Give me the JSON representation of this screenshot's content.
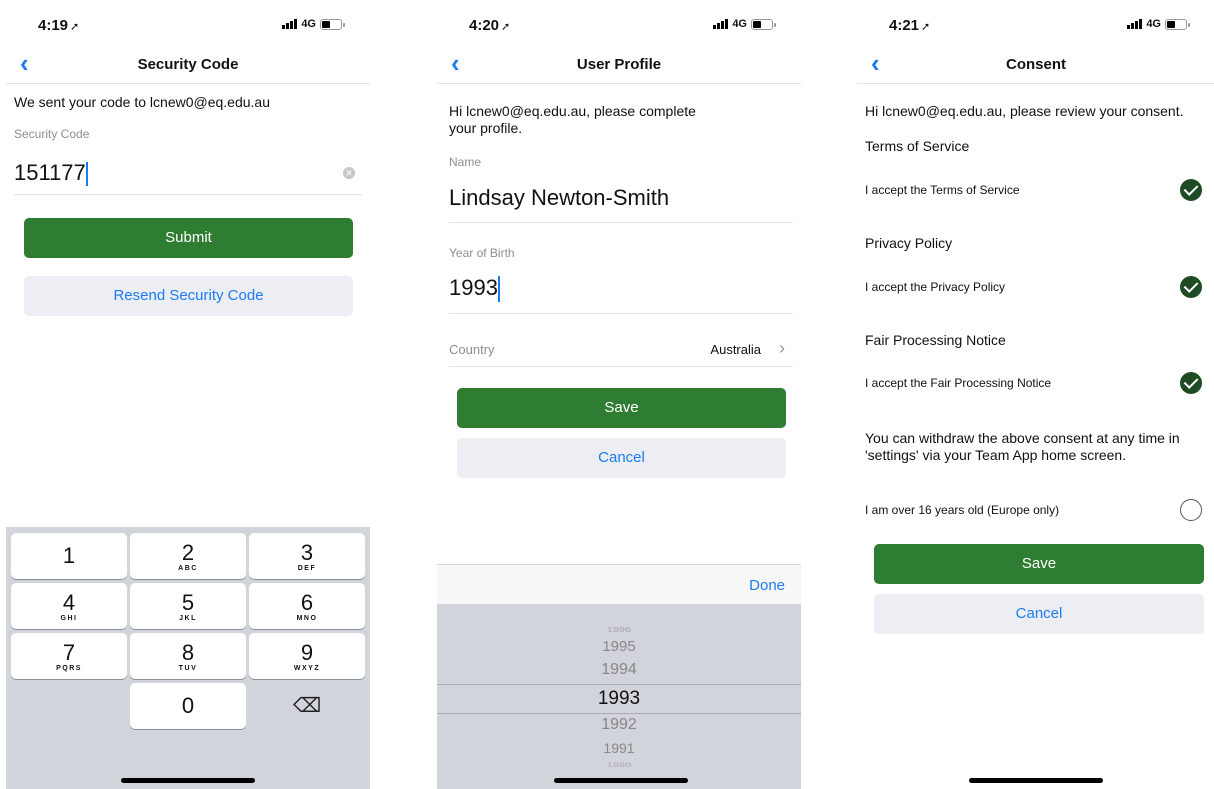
{
  "screens": [
    {
      "status": {
        "time": "4:19",
        "network": "4G"
      },
      "nav": {
        "title": "Security Code"
      },
      "info_text": "We sent your code to lcnew0@eq.edu.au",
      "field_label": "Security Code",
      "field_value": "151177",
      "submit_label": "Submit",
      "resend_label": "Resend Security Code",
      "keypad": [
        {
          "digit": "1",
          "letters": ""
        },
        {
          "digit": "2",
          "letters": "ABC"
        },
        {
          "digit": "3",
          "letters": "DEF"
        },
        {
          "digit": "4",
          "letters": "GHI"
        },
        {
          "digit": "5",
          "letters": "JKL"
        },
        {
          "digit": "6",
          "letters": "MNO"
        },
        {
          "digit": "7",
          "letters": "PQRS"
        },
        {
          "digit": "8",
          "letters": "TUV"
        },
        {
          "digit": "9",
          "letters": "WXYZ"
        },
        {
          "digit": "0",
          "letters": ""
        }
      ]
    },
    {
      "status": {
        "time": "4:20",
        "network": "4G"
      },
      "nav": {
        "title": "User Profile"
      },
      "intro_line1": "Hi lcnew0@eq.edu.au, please complete",
      "intro_line2": "your profile.",
      "name_label": "Name",
      "name_value": "Lindsay Newton-Smith",
      "year_label": "Year of Birth",
      "year_value": "1993",
      "country_label": "Country",
      "country_value": "Australia",
      "save_label": "Save",
      "cancel_label": "Cancel",
      "done_label": "Done",
      "picker_years": [
        "1996",
        "1995",
        "1994",
        "1993",
        "1992",
        "1991",
        "1990"
      ],
      "picker_selected": "1993"
    },
    {
      "status": {
        "time": "4:21",
        "network": "4G"
      },
      "nav": {
        "title": "Consent"
      },
      "intro": "Hi lcnew0@eq.edu.au, please review your consent.",
      "sections": [
        {
          "heading": "Terms of Service",
          "item": "I accept the Terms of Service",
          "checked": true
        },
        {
          "heading": "Privacy Policy",
          "item": "I accept the Privacy Policy",
          "checked": true
        },
        {
          "heading": "Fair Processing Notice",
          "item": "I accept the Fair Processing Notice",
          "checked": true
        }
      ],
      "withdraw_line1": "You can withdraw the above consent at any time in",
      "withdraw_line2": "'settings' via your Team App home screen.",
      "age_item": "I am over 16 years old (Europe only)",
      "age_checked": false,
      "save_label": "Save",
      "cancel_label": "Cancel"
    }
  ]
}
